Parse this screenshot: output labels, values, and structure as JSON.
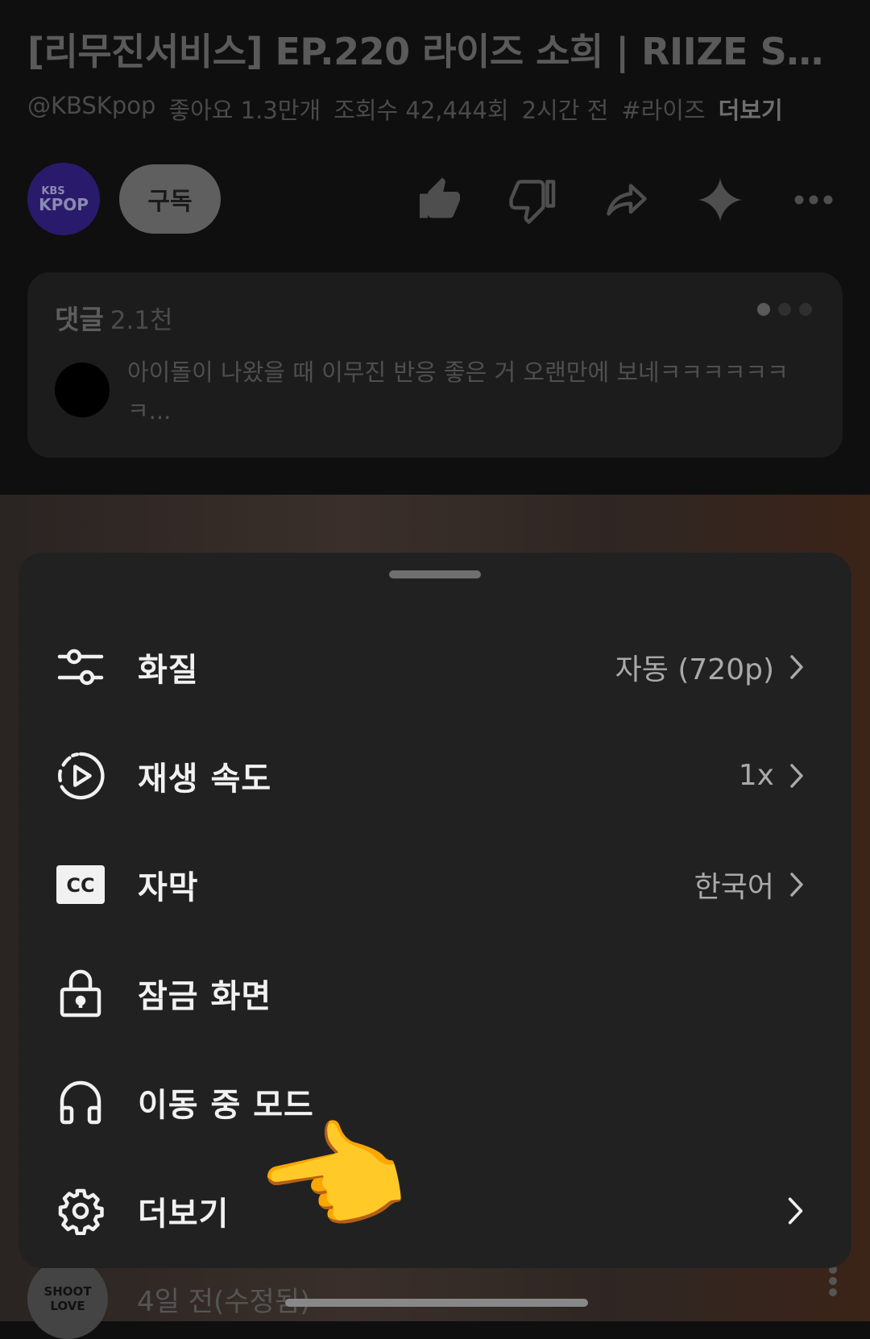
{
  "video": {
    "title": "[리무진서비스] EP.220 라이즈 소희 | RIIZE SOH...",
    "channel_handle": "@KBSKpop",
    "likes": "좋아요 1.3만개",
    "views": "조회수 42,444회",
    "time": "2시간 전",
    "hashtag": "#라이즈",
    "more": "더보기"
  },
  "channel": {
    "avatar_line1": "KBS",
    "avatar_line2": "KPOP",
    "subscribe_label": "구독"
  },
  "comments": {
    "label": "댓글",
    "count": "2.1천",
    "top_comment": "아이돌이 나왔을 때 이무진 반응 좋은 거 오랜만에 보네ㅋㅋㅋㅋㅋㅋ ㅋ..."
  },
  "next_item": {
    "avatar_text": "SHOOT LOVE",
    "time": "4일 전(수정됨)"
  },
  "sheet": {
    "items": [
      {
        "label": "화질",
        "value": "자동 (720p)"
      },
      {
        "label": "재생 속도",
        "value": "1x"
      },
      {
        "label": "자막",
        "value": "한국어"
      },
      {
        "label": "잠금 화면",
        "value": ""
      },
      {
        "label": "이동 중 모드",
        "value": ""
      },
      {
        "label": "더보기",
        "value": ""
      }
    ]
  },
  "icons": {
    "like": "thumbs-up-icon",
    "dislike": "thumbs-down-icon",
    "share": "share-icon",
    "ai": "sparkle-icon",
    "more": "more-horiz-icon"
  }
}
